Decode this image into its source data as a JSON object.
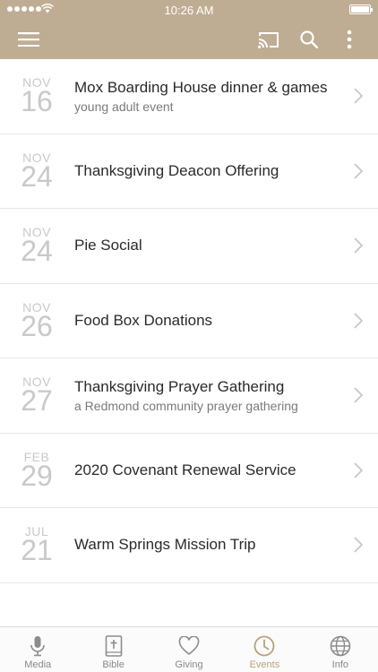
{
  "status_bar": {
    "time": "10:26 AM"
  },
  "header": {
    "background_color": "#bfad93",
    "icons": [
      "menu-icon",
      "cast-icon",
      "search-icon",
      "more-icon"
    ]
  },
  "events": [
    {
      "month": "NOV",
      "day": "16",
      "title": "Mox Boarding House dinner & games",
      "subtitle": "young adult event"
    },
    {
      "month": "NOV",
      "day": "24",
      "title": "Thanksgiving Deacon Offering",
      "subtitle": ""
    },
    {
      "month": "NOV",
      "day": "24",
      "title": "Pie Social",
      "subtitle": ""
    },
    {
      "month": "NOV",
      "day": "26",
      "title": "Food Box Donations",
      "subtitle": ""
    },
    {
      "month": "NOV",
      "day": "27",
      "title": "Thanksgiving Prayer Gathering",
      "subtitle": "a Redmond community prayer gathering"
    },
    {
      "month": "FEB",
      "day": "29",
      "title": "2020 Covenant Renewal Service",
      "subtitle": ""
    },
    {
      "month": "JUL",
      "day": "21",
      "title": "Warm Springs Mission Trip",
      "subtitle": ""
    }
  ],
  "tabbar": {
    "accent_color": "#b9a17c",
    "active_tab": "Events",
    "tabs": [
      {
        "label": "Media",
        "icon": "microphone-icon"
      },
      {
        "label": "Bible",
        "icon": "bible-icon"
      },
      {
        "label": "Giving",
        "icon": "heart-icon"
      },
      {
        "label": "Events",
        "icon": "clock-icon"
      },
      {
        "label": "Info",
        "icon": "globe-icon"
      }
    ]
  }
}
